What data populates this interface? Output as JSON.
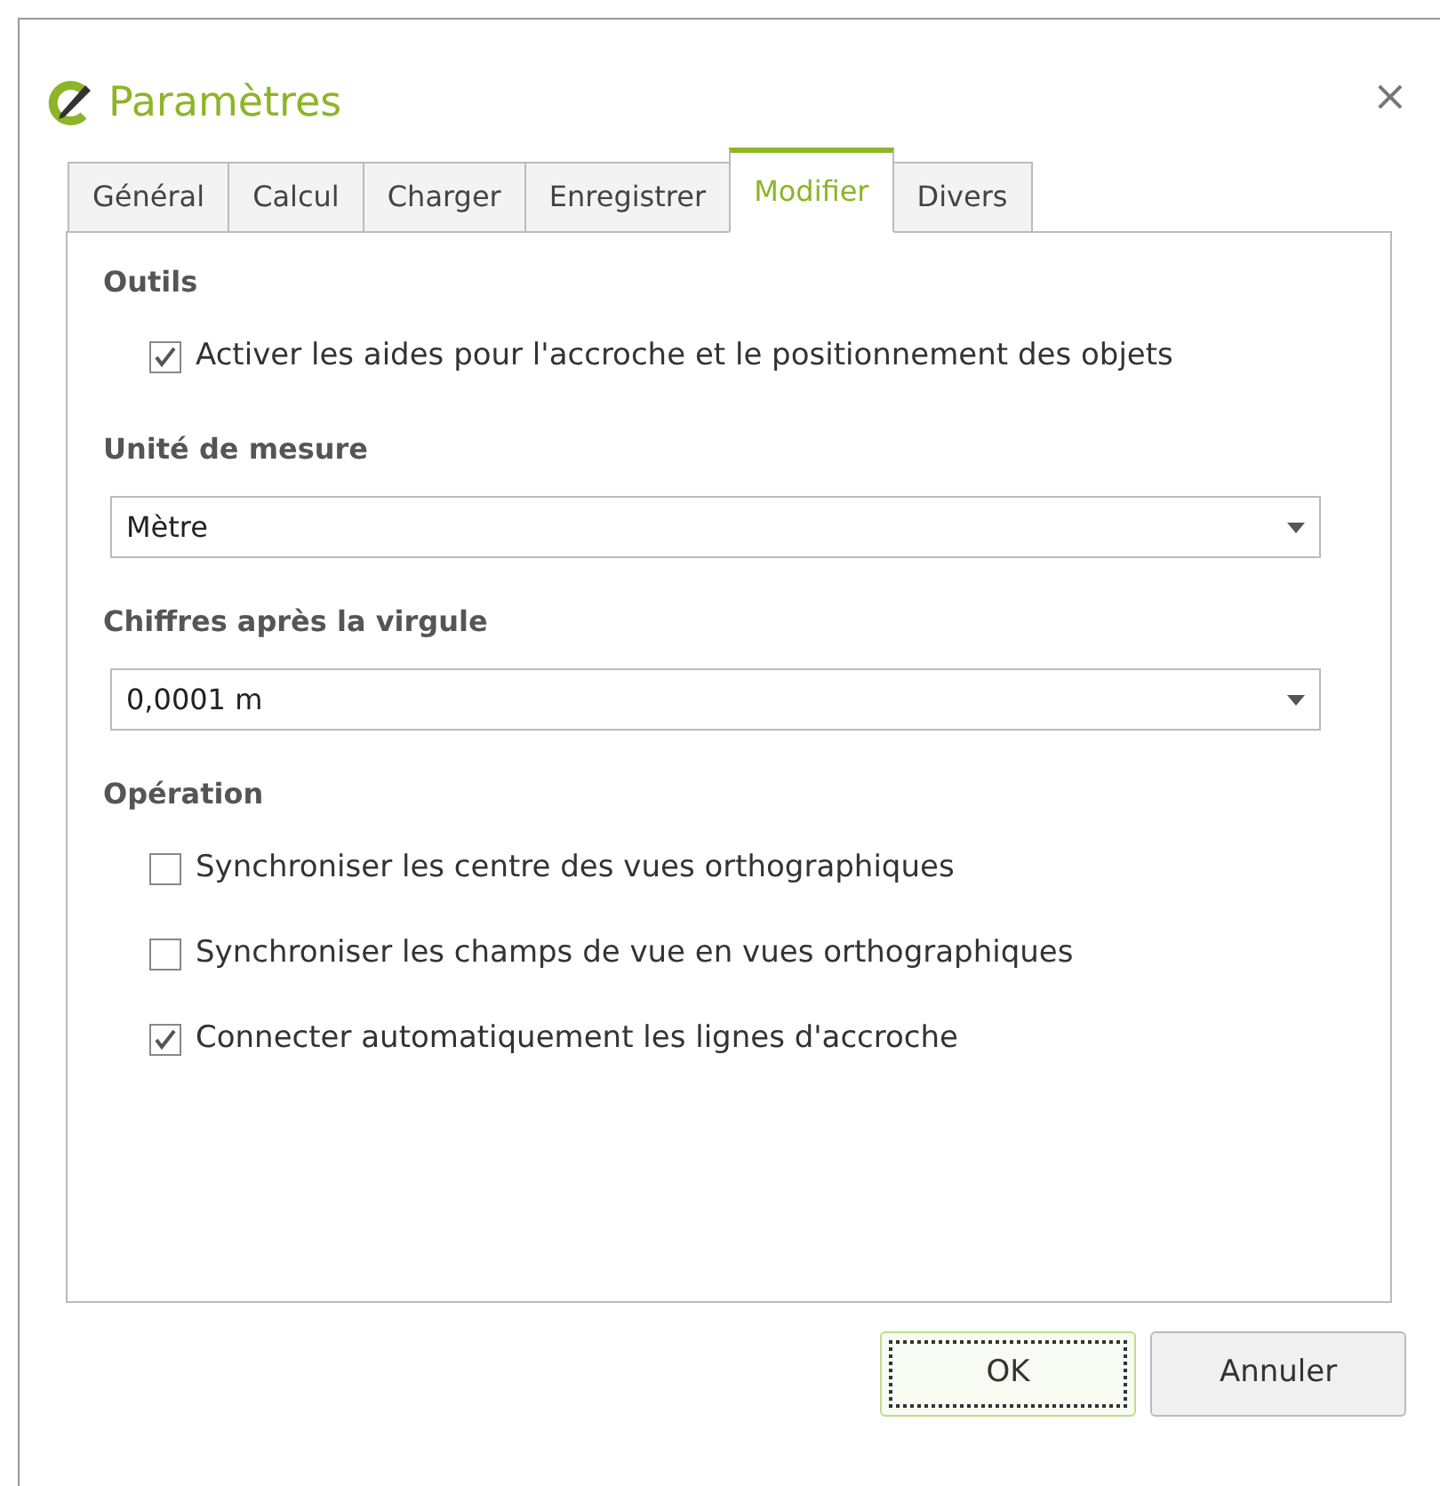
{
  "window": {
    "title": "Paramètres",
    "close": "×"
  },
  "tabs": [
    {
      "label": "Général",
      "selected": false
    },
    {
      "label": "Calcul",
      "selected": false
    },
    {
      "label": "Charger",
      "selected": false
    },
    {
      "label": "Enregistrer",
      "selected": false
    },
    {
      "label": "Modifier",
      "selected": true
    },
    {
      "label": "Divers",
      "selected": false
    }
  ],
  "sections": [
    {
      "title": "Outils",
      "items": [
        {
          "kind": "checkbox",
          "label": "Activer les aides pour l'accroche et le positionnement des objets",
          "checked": true
        }
      ]
    },
    {
      "title": "Unité de mesure",
      "items": [
        {
          "kind": "select",
          "value": "Mètre"
        }
      ]
    },
    {
      "title": "Chiffres après la virgule",
      "items": [
        {
          "kind": "select",
          "value": "0,0001 m"
        }
      ]
    },
    {
      "title": "Opération",
      "items": [
        {
          "kind": "checkbox",
          "label": "Synchroniser les centre des vues orthographiques",
          "checked": false
        },
        {
          "kind": "checkbox",
          "label": "Synchroniser les champs de vue en vues orthographiques",
          "checked": false
        },
        {
          "kind": "checkbox",
          "label": "Connecter automatiquement les lignes d'accroche",
          "checked": true
        }
      ]
    }
  ],
  "buttons": [
    {
      "label": "OK",
      "default": true
    },
    {
      "label": "Annuler",
      "default": false
    }
  ]
}
